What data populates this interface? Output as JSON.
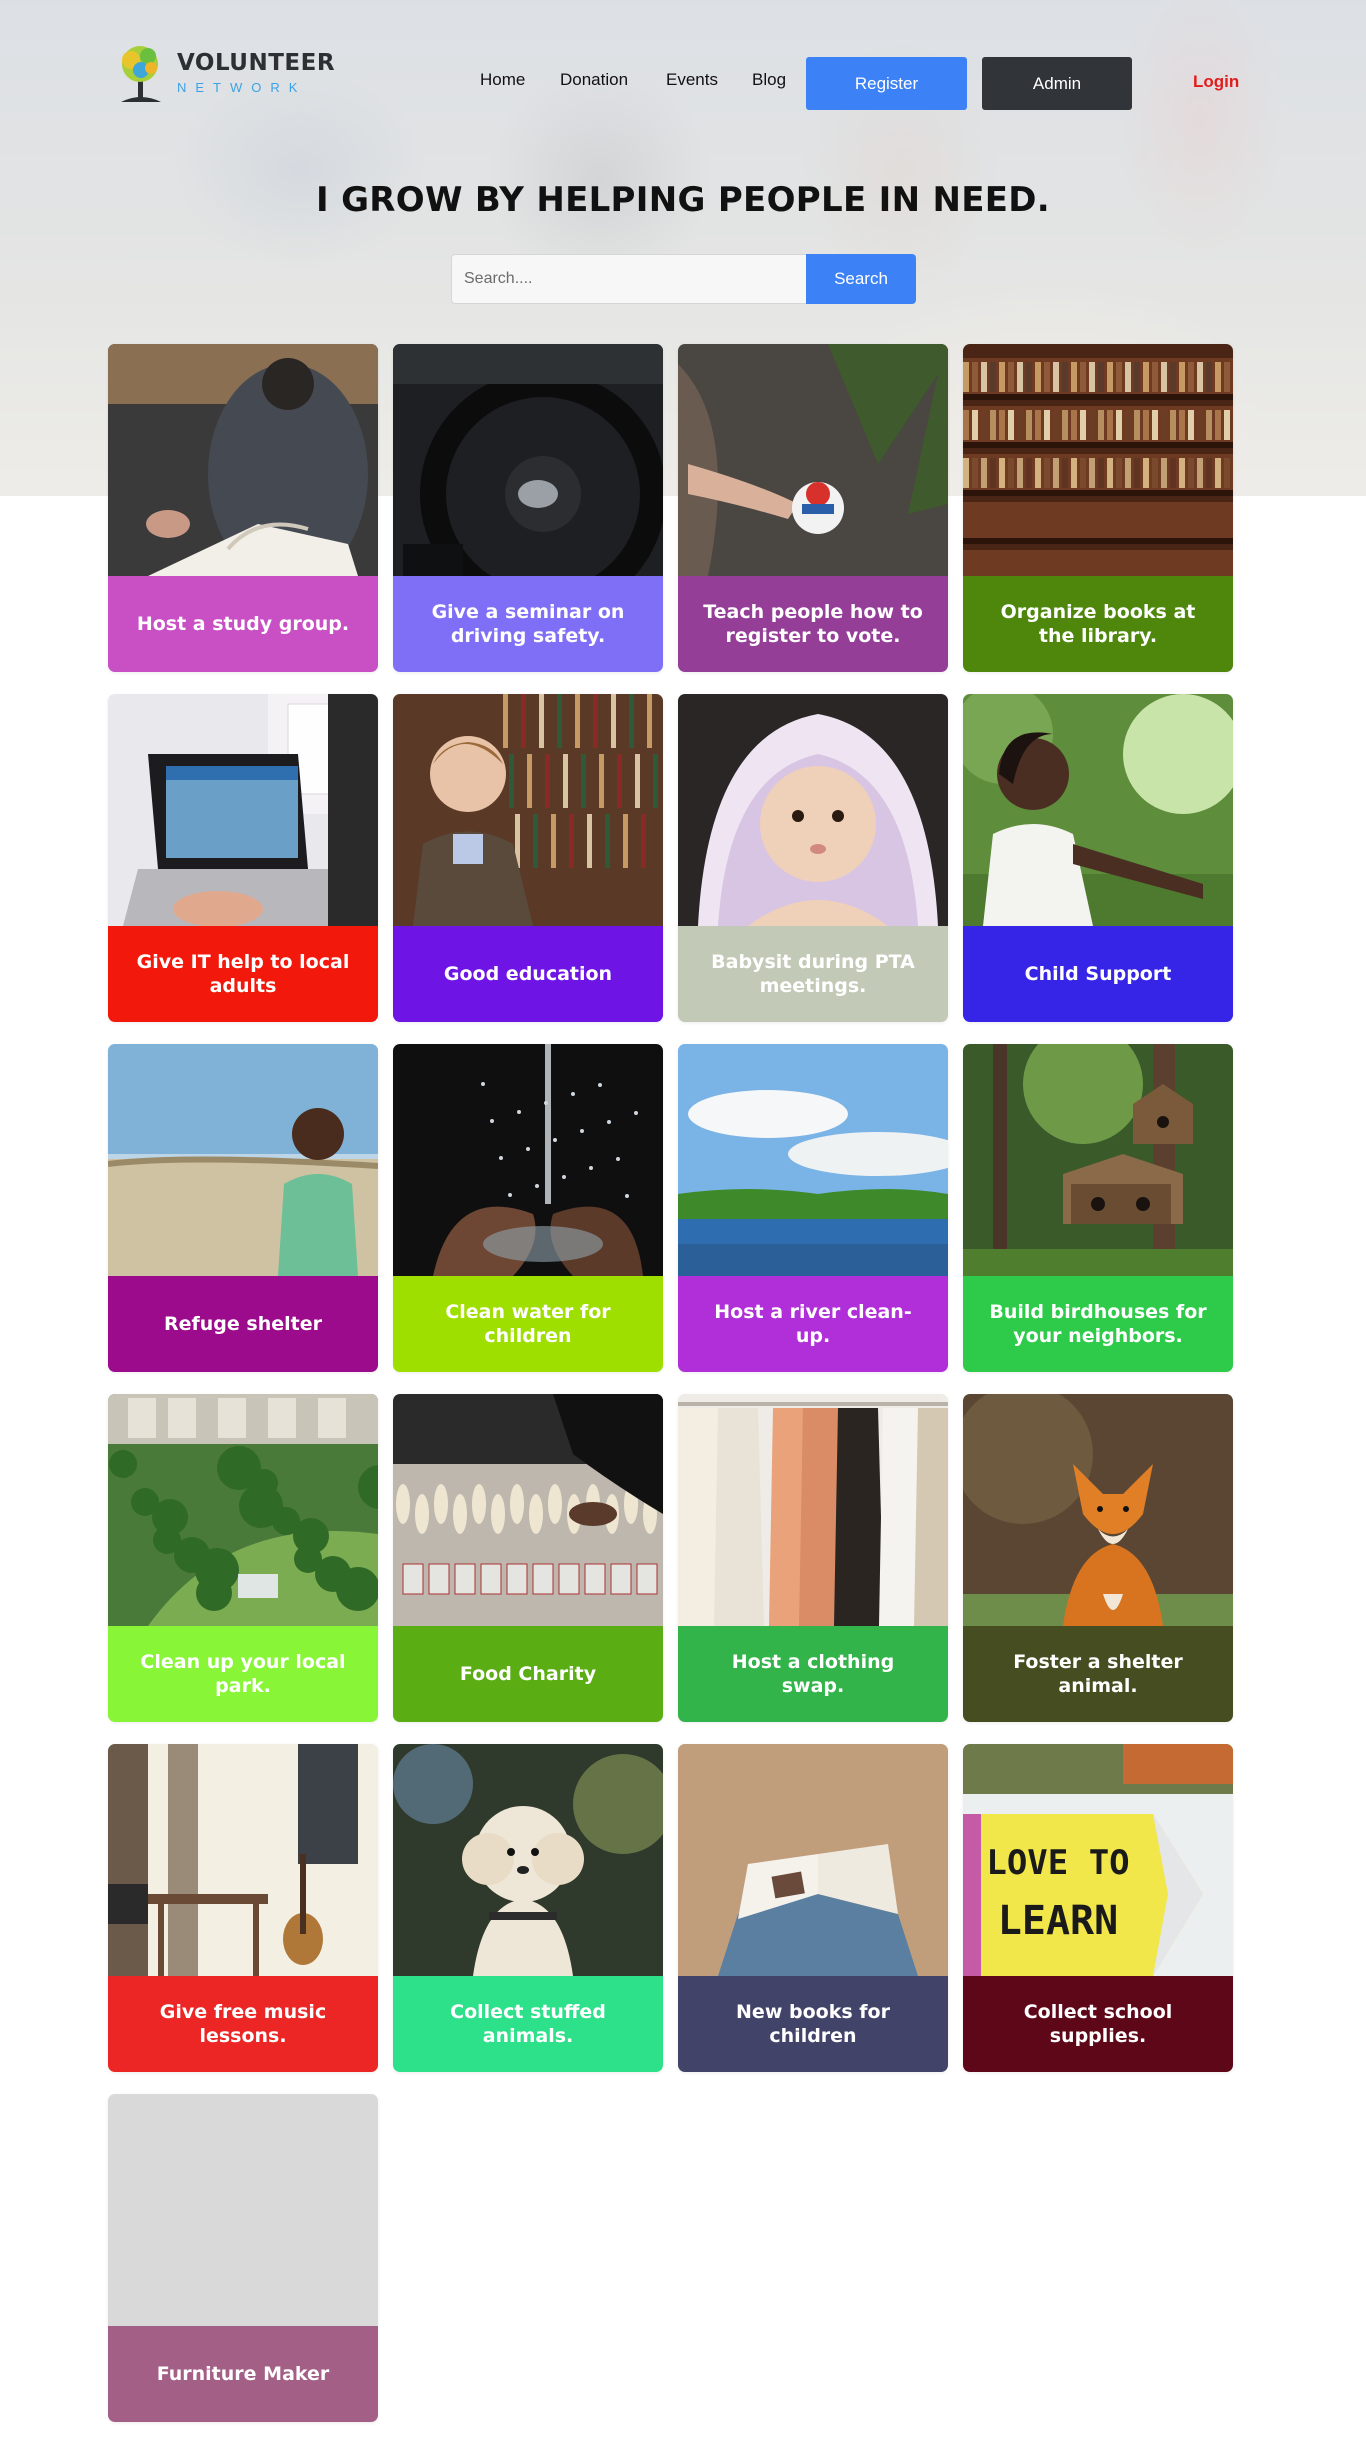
{
  "header": {
    "logo": {
      "word": "VOLUNTEER",
      "sub": "NETWORK",
      "colors": {
        "word": "#2c2f34",
        "sub": "#3aa3e6"
      }
    },
    "nav": {
      "home": "Home",
      "donation": "Donation",
      "events": "Events",
      "blog": "Blog"
    },
    "register_label": "Register",
    "admin_label": "Admin",
    "login_label": "Login"
  },
  "hero": {
    "headline": "I GROW BY HELPING PEOPLE IN NEED.",
    "search": {
      "placeholder": "Search....",
      "button_label": "Search"
    }
  },
  "colors": {
    "accent": "#3c82f6",
    "admin_button": "#31353a",
    "login": "#e01d1d"
  },
  "cards": [
    {
      "label": "Host a study group.",
      "color": "#c84fc4",
      "image": "study-group-photo"
    },
    {
      "label": "Give a seminar on driving safety.",
      "color": "#7f6ff7",
      "image": "steering-wheel-photo"
    },
    {
      "label": "Teach people how to register to vote.",
      "color": "#943e97",
      "image": "i-voted-sticker-photo"
    },
    {
      "label": "Organize books at the library.",
      "color": "#4f870d",
      "image": "library-shelves-photo"
    },
    {
      "label": "Give IT help to local adults",
      "color": "#f2180b",
      "image": "laptop-photo"
    },
    {
      "label": "Good education",
      "color": "#6e15e6",
      "image": "boy-library-photo"
    },
    {
      "label": "Babysit during PTA meetings.",
      "color": "#c3c9b7",
      "image": "baby-photo"
    },
    {
      "label": "Child Support",
      "color": "#3725e7",
      "image": "girl-outdoors-photo"
    },
    {
      "label": "Refuge shelter",
      "color": "#9b0b8b",
      "image": "boy-field-photo"
    },
    {
      "label": "Clean water for children",
      "color": "#9fdf00",
      "image": "water-hands-photo"
    },
    {
      "label": "Host a river clean-up.",
      "color": "#b02fd8",
      "image": "river-photo"
    },
    {
      "label": "Build birdhouses for your neighbors.",
      "color": "#2ecb4a",
      "image": "birdhouse-photo"
    },
    {
      "label": "Clean up your local park.",
      "color": "#88f536",
      "image": "park-aerial-photo"
    },
    {
      "label": "Food Charity",
      "color": "#5bad14",
      "image": "food-market-photo"
    },
    {
      "label": "Host a clothing swap.",
      "color": "#33b44a",
      "image": "clothes-rack-photo"
    },
    {
      "label": "Foster a shelter animal.",
      "color": "#464e21",
      "image": "fox-photo"
    },
    {
      "label": "Give free music lessons.",
      "color": "#ec2525",
      "image": "music-room-photo"
    },
    {
      "label": "Collect stuffed animals.",
      "color": "#2de08a",
      "image": "fluffy-dog-photo"
    },
    {
      "label": "New books for children",
      "color": "#424368",
      "image": "open-book-photo"
    },
    {
      "label": "Collect school supplies.",
      "color": "#5d0719",
      "image": "love-to-learn-photo"
    },
    {
      "label": "Furniture Maker",
      "color": "#a45f86",
      "image": "blank-placeholder"
    }
  ]
}
